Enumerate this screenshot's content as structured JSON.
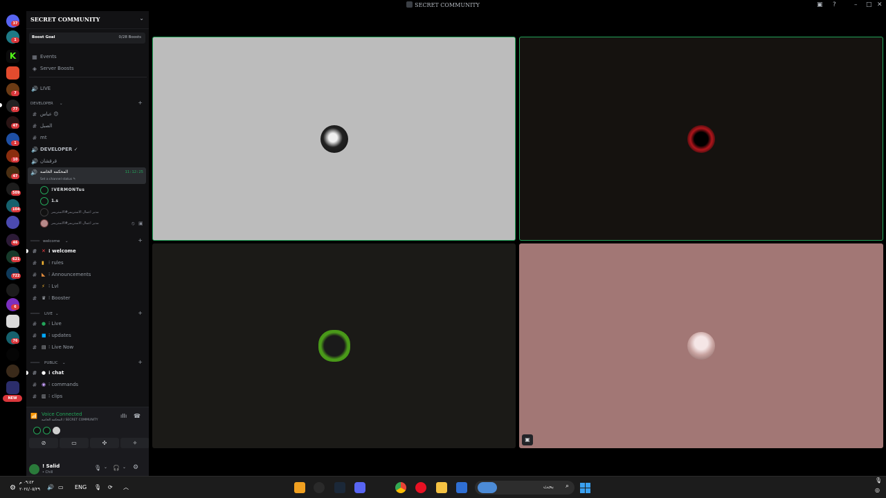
{
  "window": {
    "title": "SECRET COMMUNITY"
  },
  "rail": {
    "badges": [
      "37",
      "1",
      "7",
      "77",
      "47",
      "1",
      "10",
      "47",
      "509",
      "104",
      "46",
      "621",
      "722",
      "6",
      "76"
    ],
    "new_label": "NEW"
  },
  "guild": {
    "name": "SECRET COMMUNITY",
    "boost_label": "Boost Goal",
    "boost_count": "0/28 Boosts",
    "events": "Events",
    "server_boosts": "Server Boosts",
    "live": "LIVE"
  },
  "categories": {
    "developer": "DEVELOPER",
    "welcome": "welcome",
    "live": "LIVE",
    "public": "PUBLIC"
  },
  "channels": {
    "developer": [
      "عباس 😊",
      "الصبل",
      "mt",
      "DEVELOPER ✓",
      "قرقشان"
    ],
    "welcome": [
      "⁝ welcome",
      "⁝ rules",
      "⁝ Announcements",
      "⁝ Lvl",
      "⁝ Booster"
    ],
    "live": [
      "⁝ Live",
      "⁝ updates",
      "⁝ Live Now"
    ],
    "public": [
      "⁝ chat",
      "⁝ commands",
      "⁝ clips"
    ]
  },
  "voice_channel": {
    "name": "المحكمه الخاصه",
    "status": "Set a channel status ✎",
    "time": "11:12:25",
    "users": [
      "!VERMONTus",
      "1.s",
      "مدير اعمال الاستريمر#الاستريمر",
      "مدير اعمال الاستريمر#الاستريمر"
    ]
  },
  "voice_panel": {
    "status": "Voice Connected",
    "location": "المحكمه الخاصه / SECRET COMMUNITY"
  },
  "user": {
    "name": "! Salid",
    "status": "• Chill"
  },
  "taskbar": {
    "time": "٠٩:٤٣ م",
    "date": "٢٠٢٤/٠٥/٢٩",
    "lang": "ENG",
    "search_placeholder": "بحث"
  },
  "colors": {
    "speaking": "#23a55a",
    "tile1": "#bcbcbc",
    "tile2": "#15120f",
    "tile3": "#1b1a17",
    "tile4": "#a27775"
  }
}
